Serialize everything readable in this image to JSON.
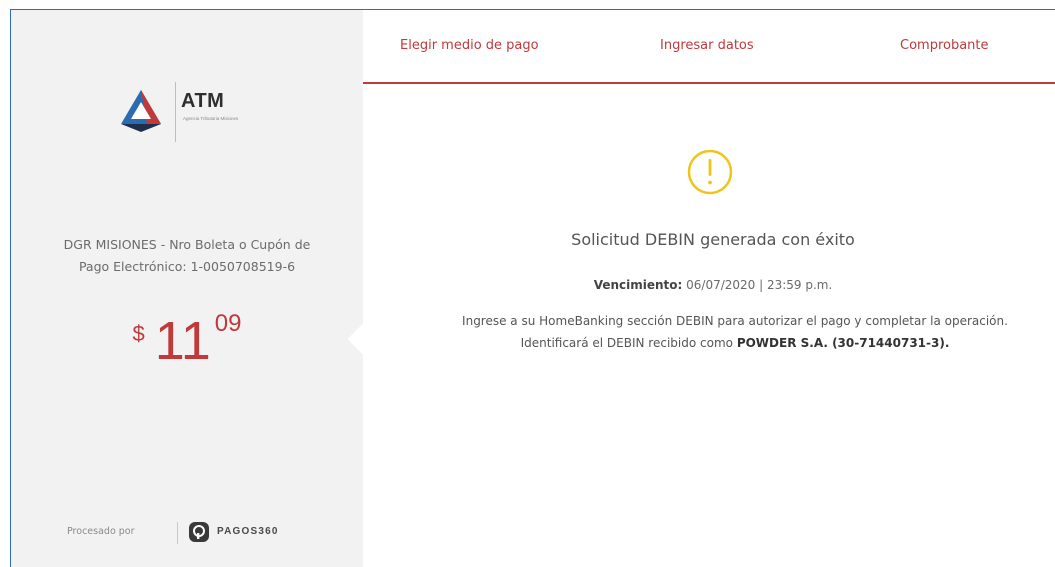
{
  "brand": {
    "name": "ATM",
    "subtitle": "Agencia Tributaria Misiones",
    "colors": {
      "accent": "#c0393b",
      "frame": "#2d6fb5",
      "warning": "#f0c419"
    }
  },
  "left": {
    "concept_line1": "DGR MISIONES - Nro Boleta o Cupón de",
    "concept_line2": "Pago Electrónico: 1-0050708519-6",
    "amount": {
      "currency": "$",
      "integer": "11",
      "decimal": "09"
    },
    "footer": {
      "processed_by": "Procesado por",
      "processor": "PAGOS360"
    }
  },
  "tabs": [
    {
      "label": "Elegir medio de pago"
    },
    {
      "label": "Ingresar datos"
    },
    {
      "label": "Comprobante"
    }
  ],
  "result": {
    "icon": "warning-icon",
    "title": "Solicitud DEBIN generada con éxito",
    "due_label": "Vencimiento:",
    "due_value": "06/07/2020 | 23:59 p.m.",
    "instructions_line1": "Ingrese a su HomeBanking sección DEBIN para autorizar el pago y completar la operación.",
    "instructions_line2_prefix": "Identificará el DEBIN recibido como",
    "instructions_line2_strong": "POWDER S.A. (30-71440731-3)."
  }
}
